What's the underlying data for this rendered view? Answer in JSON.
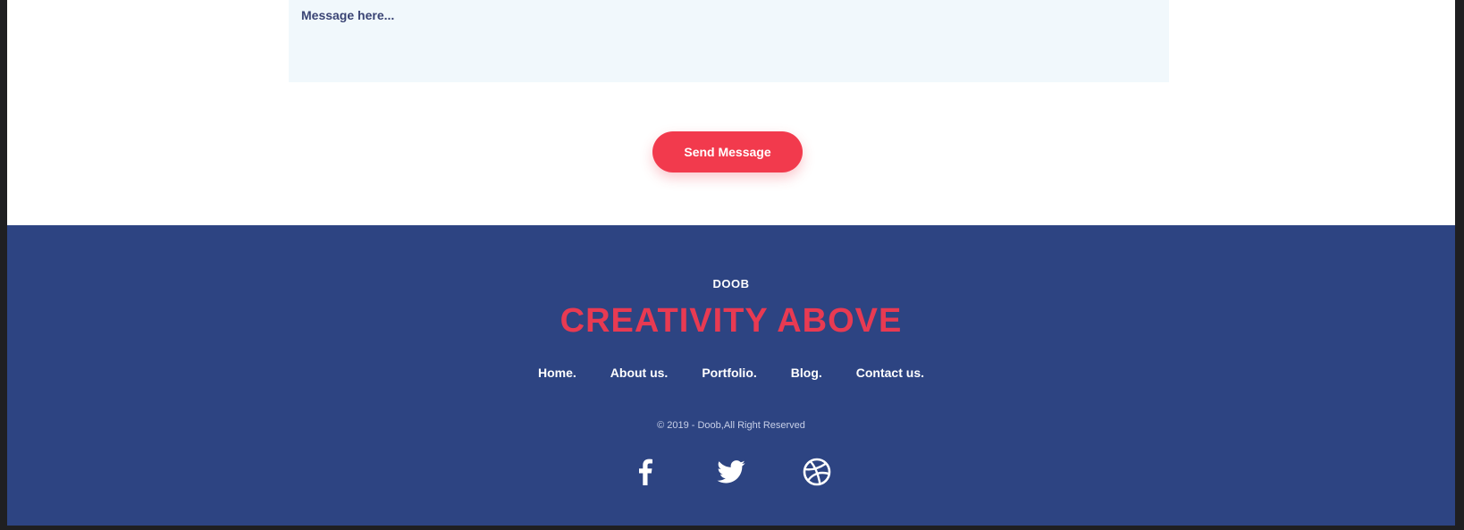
{
  "form": {
    "message_placeholder": "Message here...",
    "send_label": "Send Message"
  },
  "footer": {
    "brand": "DOOB",
    "tagline": "CREATIVITY ABOVE",
    "nav": [
      "Home.",
      "About us.",
      "Portfolio.",
      "Blog.",
      "Contact us."
    ],
    "copyright": "© 2019 - Doob,All Right Reserved",
    "social_icons": [
      "facebook-icon",
      "twitter-icon",
      "dribbble-icon"
    ]
  },
  "colors": {
    "accent": "#f23a4d",
    "footer_bg": "#2d4482",
    "input_bg": "#f1f8fc",
    "tagline": "#e83a52"
  }
}
